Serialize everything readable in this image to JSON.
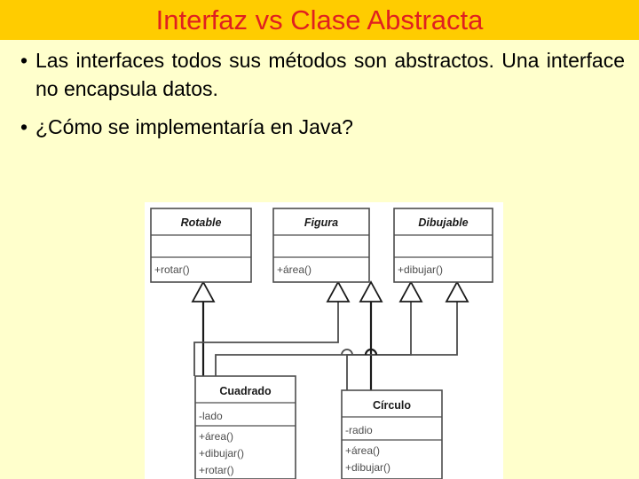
{
  "slide": {
    "title": "Interfaz vs Clase Abstracta",
    "title_bg_color": "#ffcc00",
    "title_text_color": "#e02020",
    "background_color": "#ffffcc",
    "bullet_glyph": "•"
  },
  "bullets": [
    {
      "marker": "•",
      "text": "Las interfaces todos sus métodos son abstractos. Una interface no encapsula datos."
    },
    {
      "marker": "•",
      "text": "¿Cómo se implementaría en Java?"
    }
  ],
  "diagram": {
    "type": "uml-class-diagram",
    "background_color": "#ffffff",
    "classes": [
      {
        "id": "rotable",
        "name": "Rotable",
        "stereotype": "interface",
        "italic": true,
        "attributes": [],
        "operations": [
          "+rotar()"
        ]
      },
      {
        "id": "figura",
        "name": "Figura",
        "stereotype": "interface",
        "italic": true,
        "attributes": [],
        "operations": [
          "+área()"
        ]
      },
      {
        "id": "dibujable",
        "name": "Dibujable",
        "stereotype": "interface",
        "italic": true,
        "attributes": [],
        "operations": [
          "+dibujar()"
        ]
      },
      {
        "id": "cuadrado",
        "name": "Cuadrado",
        "stereotype": "class",
        "italic": false,
        "attributes": [
          "-lado"
        ],
        "operations": [
          "+área()",
          "+dibujar()",
          "+rotar()"
        ]
      },
      {
        "id": "circulo",
        "name": "Círculo",
        "stereotype": "class",
        "italic": false,
        "attributes": [
          "-radio"
        ],
        "operations": [
          "+área()",
          "+dibujar()"
        ]
      }
    ],
    "relations": [
      {
        "from": "cuadrado",
        "to": "rotable",
        "kind": "realization"
      },
      {
        "from": "cuadrado",
        "to": "figura",
        "kind": "realization"
      },
      {
        "from": "cuadrado",
        "to": "dibujable",
        "kind": "realization"
      },
      {
        "from": "circulo",
        "to": "figura",
        "kind": "realization"
      },
      {
        "from": "circulo",
        "to": "dibujable",
        "kind": "realization"
      }
    ]
  }
}
